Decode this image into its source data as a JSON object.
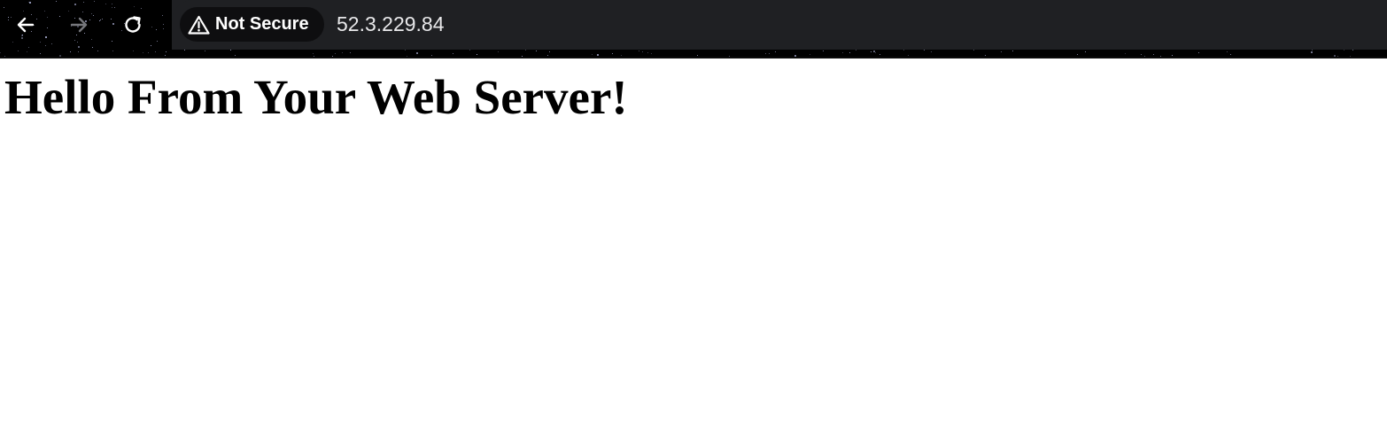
{
  "browser": {
    "toolbar": {
      "back_icon": "arrow-left-icon",
      "forward_icon": "arrow-right-icon",
      "reload_icon": "reload-icon",
      "forward_enabled": false
    },
    "address_bar": {
      "security_label": "Not Secure",
      "security_icon": "warning-triangle-icon",
      "url": "52.3.229.84"
    },
    "colors": {
      "toolbar_bg": "#1f2023",
      "chip_bg": "#0e0e10",
      "page_bg": "#ffffff",
      "text_light": "#ffffff"
    }
  },
  "page": {
    "heading": "Hello From Your Web Server!"
  }
}
